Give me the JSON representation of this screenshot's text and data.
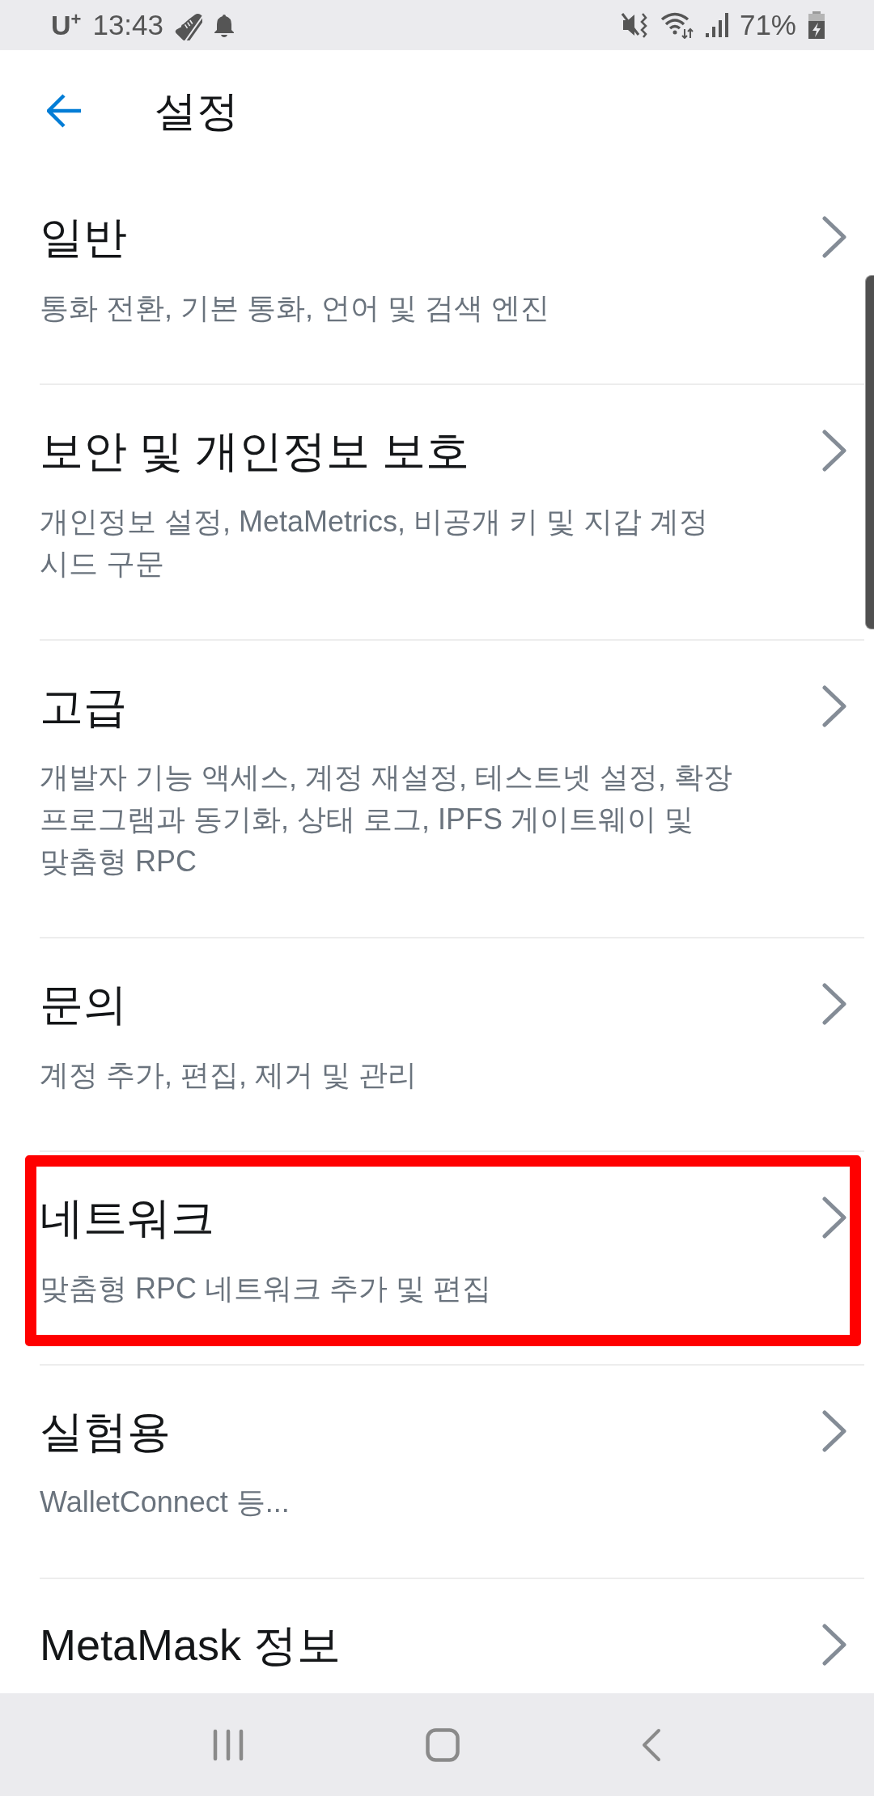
{
  "status_bar": {
    "carrier": "U$^{+}$",
    "time": "13:43",
    "battery": "71%"
  },
  "header": {
    "title": "설정"
  },
  "settings": [
    {
      "title": "일반",
      "description": "통화 전환, 기본 통화, 언어 및 검색 엔진",
      "highlighted": false
    },
    {
      "title": "보안 및 개인정보 보호",
      "description": "개인정보 설정, MetaMetrics, 비공개 키 및 지갑 계정 시드 구문",
      "highlighted": false
    },
    {
      "title": "고급",
      "description": "개발자 기능 액세스, 계정 재설정, 테스트넷 설정, 확장 프로그램과 동기화, 상태 로그, IPFS 게이트웨이 및 맞춤형 RPC",
      "highlighted": false
    },
    {
      "title": "문의",
      "description": "계정 추가, 편집, 제거 및 관리",
      "highlighted": false
    },
    {
      "title": "네트워크",
      "description": "맞춤형 RPC 네트워크 추가 및 편집",
      "highlighted": true
    },
    {
      "title": "실험용",
      "description": "WalletConnect 등...",
      "highlighted": false
    },
    {
      "title": "MetaMask 정보",
      "highlighted": false
    }
  ]
}
